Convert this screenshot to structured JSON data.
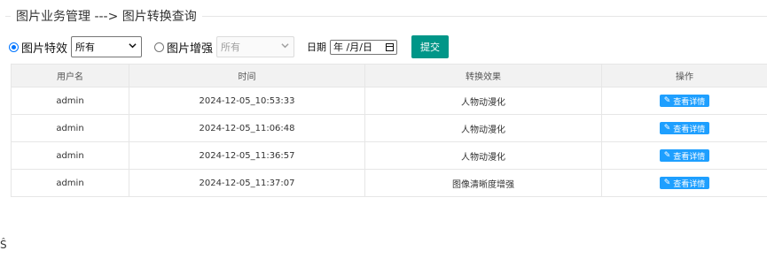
{
  "breadcrumb": "图片业务管理 ---> 图片转换查询",
  "filters": {
    "radio1": {
      "label": "图片特效",
      "checked": true
    },
    "select1": {
      "value": "所有"
    },
    "radio2": {
      "label": "图片增强",
      "checked": false
    },
    "select2": {
      "value": "所有"
    },
    "date_label": "日期",
    "date_placeholder": "年 /月/日",
    "submit_label": "提交"
  },
  "table": {
    "headers": [
      "用户名",
      "时间",
      "转换效果",
      "操作"
    ],
    "rows": [
      {
        "user": "admin",
        "time": "2024-12-05_10:53:33",
        "effect": "人物动漫化",
        "action": "查看详情"
      },
      {
        "user": "admin",
        "time": "2024-12-05_11:06:48",
        "effect": "人物动漫化",
        "action": "查看详情"
      },
      {
        "user": "admin",
        "time": "2024-12-05_11:36:57",
        "effect": "人物动漫化",
        "action": "查看详情"
      },
      {
        "user": "admin",
        "time": "2024-12-05_11:37:07",
        "effect": "图像清晰度增强",
        "action": "查看详情"
      }
    ]
  },
  "icons": {
    "radio": "radio-icon",
    "chevron": "chevron-down-icon",
    "calendar": "calendar-icon",
    "edit": "edit-icon"
  },
  "colors": {
    "submit": "#009688",
    "detail": "#1e9fff",
    "header_bg": "#f2f2f2"
  },
  "stray_glyph": "Ŝ"
}
